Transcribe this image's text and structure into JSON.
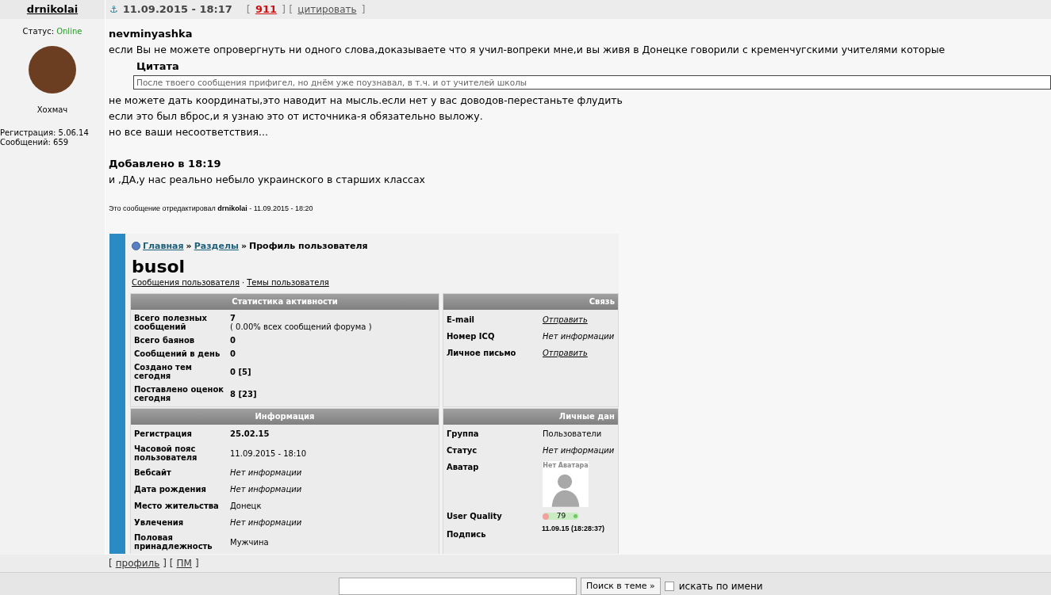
{
  "post": {
    "author": "drnikolai",
    "anchor": "⚓",
    "date": "11.09.2015 - 18:17",
    "karma": "911",
    "quote_link": "цитировать",
    "status_label": "Статус:",
    "status": "Online",
    "online": true,
    "rank": "Хохмач",
    "registered": "Регистрация: 5.06.14",
    "messages": "Сообщений: 659"
  },
  "body": {
    "addressee": "nevminyashka",
    "line_1": "если Вы не можете опровергнуть ни одного слова,доказываете что я учил-вопреки мне,и вы живя в Донецке говорили с кременчугскими учителями которые",
    "quote_title": "Цитата",
    "quote_text": "После твоего сообщения прифигел, но днём уже поузнавал, в т.ч. и от учителей школы",
    "lines": [
      "не можете дать координаты,это наводит на мысль.если нет у вас доводов-перестаньте флудить",
      "если это был вброс,и я узнаю это от источника-я обязательно выложу.",
      "но все ваши несоответствия..."
    ],
    "added_title": "Добавлено в 18:19",
    "added_text": "и ,ДА,у нас реально небыло украинского в старших классах",
    "edited": "Это сообщение отредактировал **drnikolai** - 11.09.2015 - 18:20"
  },
  "embedded": {
    "crumbs": [
      "Главная",
      "Разделы"
    ],
    "sep": "»",
    "crumb_current": "Профиль пользователя",
    "username": "busol",
    "links": [
      "Сообщения пользователя",
      "Темы пользователя"
    ],
    "link_sep": "·",
    "stats": {
      "title": "Статистика активности",
      "rows": [
        {
          "label": "Всего полезных сообщений",
          "value": "7",
          "note": "( 0.00% всех сообщений форума )"
        },
        {
          "label": "Всего баянов",
          "value": "0"
        },
        {
          "label": "Сообщений в день",
          "value": "0"
        },
        {
          "label": "Создано тем сегодня",
          "value": "0 [5]"
        },
        {
          "label": "Поставлено оценок сегодня",
          "value": "8 [23]"
        }
      ]
    },
    "contact": {
      "title": "Связь",
      "rows": [
        {
          "label": "E-mail",
          "value": "Отправить",
          "kind": "link"
        },
        {
          "label": "Номер ICQ",
          "value": "Нет информации",
          "kind": "empty"
        },
        {
          "label": "Личное письмо",
          "value": "Отправить",
          "kind": "link"
        }
      ]
    },
    "info": {
      "title": "Информация",
      "rows": [
        {
          "label": "Регистрация",
          "value": "25.02.15",
          "kind": "bold"
        },
        {
          "label": "Часовой пояс пользователя",
          "value": "11.09.2015 - 18:10",
          "kind": "plain"
        },
        {
          "label": "Вебсайт",
          "value": "Нет информации",
          "kind": "empty"
        },
        {
          "label": "Дата рождения",
          "value": "Нет информации",
          "kind": "empty"
        },
        {
          "label": "Место жительства",
          "value": "Донецк",
          "kind": "plain"
        },
        {
          "label": "Увлечения",
          "value": "Нет информации",
          "kind": "empty"
        },
        {
          "label": "Половая принадлежность",
          "value": "Мужчина",
          "kind": "plain"
        }
      ]
    },
    "personal": {
      "title": "Личные дан",
      "group_label": "Группа",
      "group": "Пользователи",
      "status_label": "Статус",
      "status": "Нет информации",
      "avatar_label": "Аватар",
      "avatar_text": "Нет Аватара",
      "quality_label": "User Quality",
      "quality": "79",
      "signature_label": "Подпись",
      "signature": "11.09.15 (18:28:37)"
    }
  },
  "brackets": {
    "open": "[",
    "middle": "] [",
    "close": "]"
  },
  "footer_links": [
    "профиль",
    "ПМ"
  ],
  "search": {
    "button": "Поиск в теме »",
    "checkbox_label": "искать по имени",
    "checked": false
  }
}
